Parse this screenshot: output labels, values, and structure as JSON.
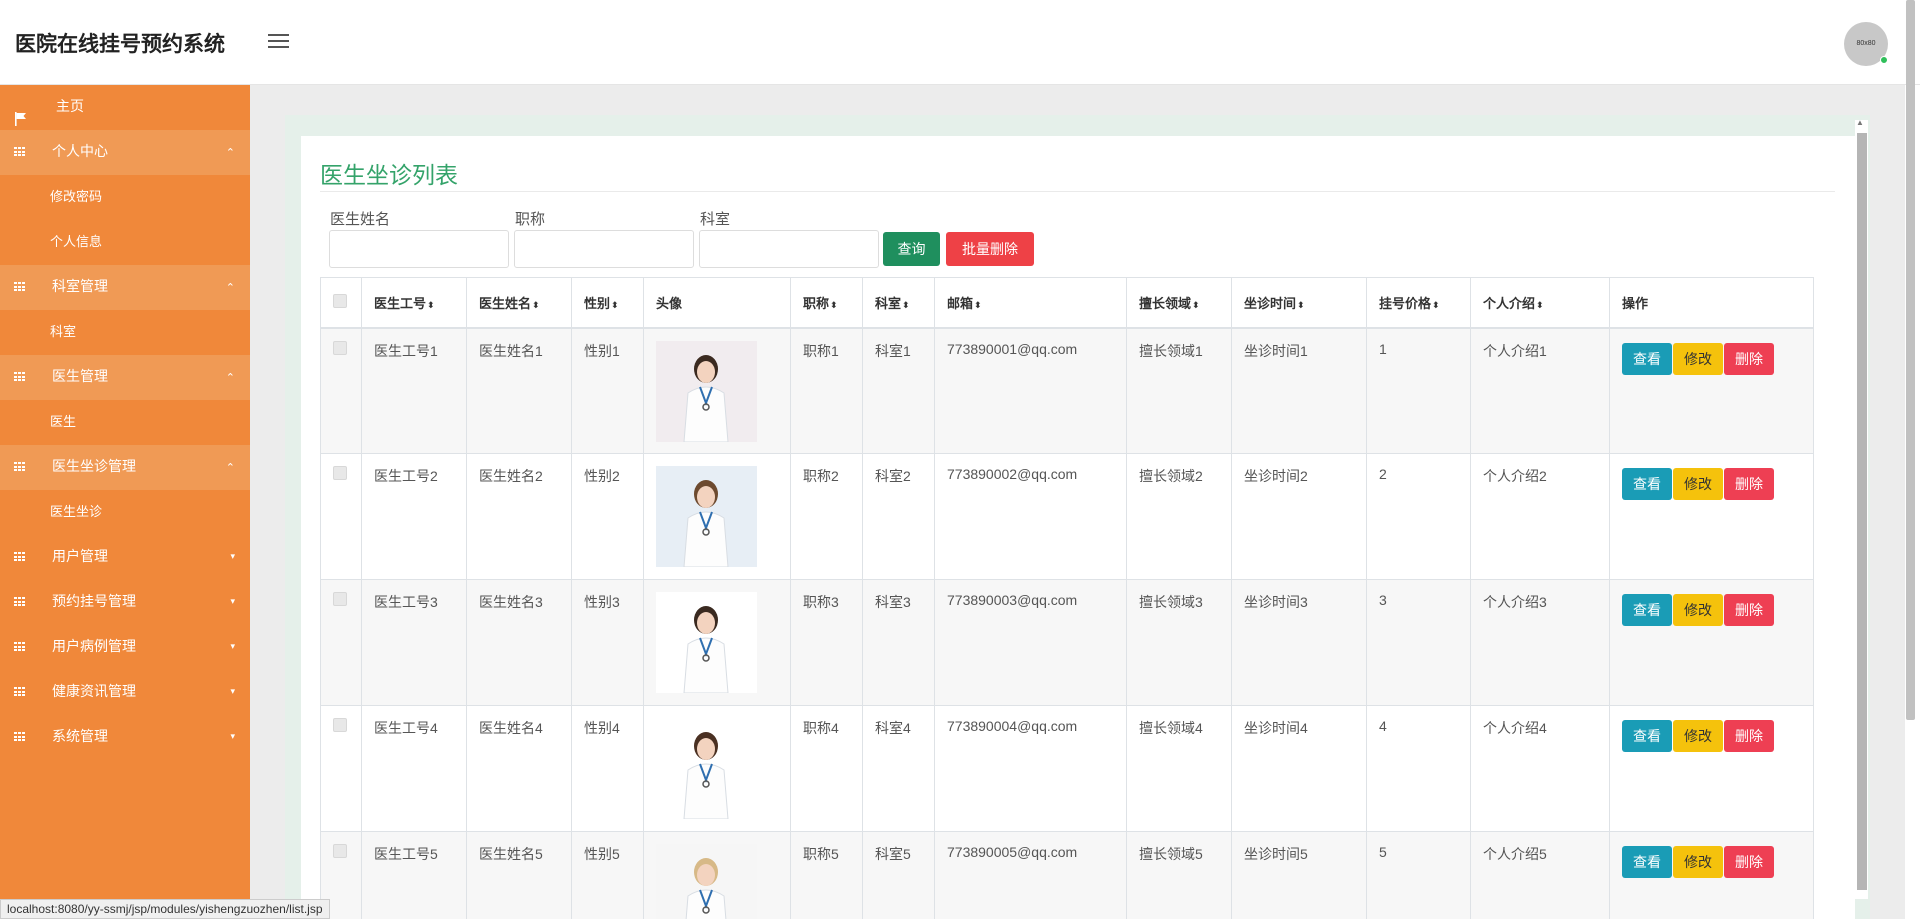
{
  "app": {
    "title": "医院在线挂号预约系统",
    "avatar_text": "80x80"
  },
  "sidebar": {
    "items": [
      {
        "label": "主页",
        "kind": "home",
        "icon": "flag-icon"
      },
      {
        "label": "个人中心",
        "kind": "group",
        "expanded": true,
        "icon": "grid-icon"
      },
      {
        "label": "修改密码",
        "kind": "sub"
      },
      {
        "label": "个人信息",
        "kind": "sub"
      },
      {
        "label": "科室管理",
        "kind": "group",
        "expanded": true,
        "icon": "grid-icon"
      },
      {
        "label": "科室",
        "kind": "sub"
      },
      {
        "label": "医生管理",
        "kind": "group",
        "expanded": true,
        "icon": "grid-icon"
      },
      {
        "label": "医生",
        "kind": "sub"
      },
      {
        "label": "医生坐诊管理",
        "kind": "group",
        "expanded": true,
        "icon": "grid-icon"
      },
      {
        "label": "医生坐诊",
        "kind": "sub"
      },
      {
        "label": "用户管理",
        "kind": "group",
        "expanded": false,
        "icon": "grid-icon"
      },
      {
        "label": "预约挂号管理",
        "kind": "group",
        "expanded": false,
        "icon": "grid-icon"
      },
      {
        "label": "用户病例管理",
        "kind": "group",
        "expanded": false,
        "icon": "grid-icon"
      },
      {
        "label": "健康资讯管理",
        "kind": "group",
        "expanded": false,
        "icon": "grid-icon"
      },
      {
        "label": "系统管理",
        "kind": "group",
        "expanded": false,
        "icon": "grid-icon"
      }
    ]
  },
  "page": {
    "title": "医生坐诊列表"
  },
  "filters": {
    "doctor_name_label": "医生姓名",
    "doctor_name_value": "",
    "title_label": "职称",
    "title_value": "",
    "department_label": "科室",
    "department_value": "",
    "search_label": "查询",
    "batch_delete_label": "批量删除"
  },
  "table": {
    "columns": [
      "医生工号",
      "医生姓名",
      "性别",
      "头像",
      "职称",
      "科室",
      "邮箱",
      "擅长领域",
      "坐诊时间",
      "挂号价格",
      "个人介绍",
      "操作"
    ],
    "rows": [
      {
        "id": "医生工号1",
        "name": "医生姓名1",
        "gender": "性别1",
        "title": "职称1",
        "dept": "科室1",
        "email": "773890001@qq.com",
        "specialty": "擅长领域1",
        "time": "坐诊时间1",
        "price": "1",
        "intro": "个人介绍1"
      },
      {
        "id": "医生工号2",
        "name": "医生姓名2",
        "gender": "性别2",
        "title": "职称2",
        "dept": "科室2",
        "email": "773890002@qq.com",
        "specialty": "擅长领域2",
        "time": "坐诊时间2",
        "price": "2",
        "intro": "个人介绍2"
      },
      {
        "id": "医生工号3",
        "name": "医生姓名3",
        "gender": "性别3",
        "title": "职称3",
        "dept": "科室3",
        "email": "773890003@qq.com",
        "specialty": "擅长领域3",
        "time": "坐诊时间3",
        "price": "3",
        "intro": "个人介绍3"
      },
      {
        "id": "医生工号4",
        "name": "医生姓名4",
        "gender": "性别4",
        "title": "职称4",
        "dept": "科室4",
        "email": "773890004@qq.com",
        "specialty": "擅长领域4",
        "time": "坐诊时间4",
        "price": "4",
        "intro": "个人介绍4"
      },
      {
        "id": "医生工号5",
        "name": "医生姓名5",
        "gender": "性别5",
        "title": "职称5",
        "dept": "科室5",
        "email": "773890005@qq.com",
        "specialty": "擅长领域5",
        "time": "坐诊时间5",
        "price": "5",
        "intro": "个人介绍5"
      }
    ],
    "actions": {
      "view": "查看",
      "edit": "修改",
      "delete": "删除"
    }
  },
  "status_bar": {
    "url": "localhost:8080/yy-ssmj/jsp/modules/yishengzuozhen/list.jsp"
  },
  "colors": {
    "sidebar": "#f0883a",
    "sidebar_group": "#f09a55",
    "title_green": "#34a36a",
    "search_btn": "#1f8f5e",
    "danger": "#ee4146",
    "view_btn": "#1a9cb6",
    "edit_btn": "#f5c20c"
  }
}
